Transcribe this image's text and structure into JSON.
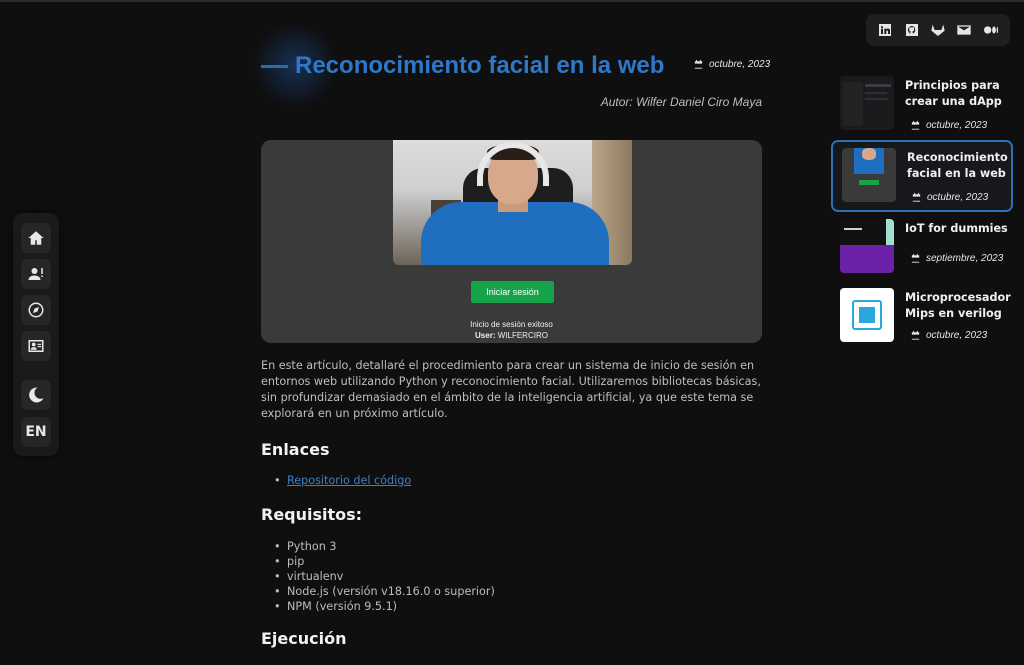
{
  "sidebar": {
    "items": [
      {
        "name": "home-icon"
      },
      {
        "name": "about-icon"
      },
      {
        "name": "explore-icon"
      },
      {
        "name": "contact-card-icon"
      },
      {
        "name": "dark-mode-icon"
      }
    ],
    "lang_label": "EN"
  },
  "social": [
    "linkedin-icon",
    "github-icon",
    "gitlab-icon",
    "email-icon",
    "medium-icon"
  ],
  "article": {
    "title": "Reconocimiento facial en la web",
    "date": "octubre, 2023",
    "author": "Autor: Wilfer Daniel Ciro Maya",
    "hero": {
      "button_label": "Iniciar sesión",
      "status_text": "Inicio de sesión exitoso",
      "user_label": "User:",
      "user_value": "WILFERCIRO"
    },
    "intro": "En este artículo, detallaré el procedimiento para crear un sistema de inicio de sesión en entornos web utilizando Python y reconocimiento facial. Utilizaremos bibliotecas básicas, sin profundizar demasiado en el ámbito de la inteligencia artificial, ya que este tema se explorará en un próximo artículo.",
    "sections": {
      "links_heading": "Enlaces",
      "links": [
        "Repositorio del código"
      ],
      "requirements_heading": "Requisitos:",
      "requirements": [
        "Python 3",
        "pip",
        "virtualenv",
        "Node.js (versión v18.16.0 o superior)",
        "NPM (versión 9.5.1)"
      ],
      "execution_heading": "Ejecución"
    }
  },
  "related": [
    {
      "title": "Principios para crear una dApp",
      "date": "octubre, 2023",
      "active": false
    },
    {
      "title": "Reconocimiento facial en la web",
      "date": "octubre, 2023",
      "active": true
    },
    {
      "title": "IoT for dummies",
      "date": "septiembre, 2023",
      "active": false
    },
    {
      "title": "Microprocesador Mips en verilog",
      "date": "octubre, 2023",
      "active": false
    }
  ],
  "colors": {
    "accent": "#2f77c9",
    "button_green": "#16a34a",
    "background": "#0f0f10"
  }
}
